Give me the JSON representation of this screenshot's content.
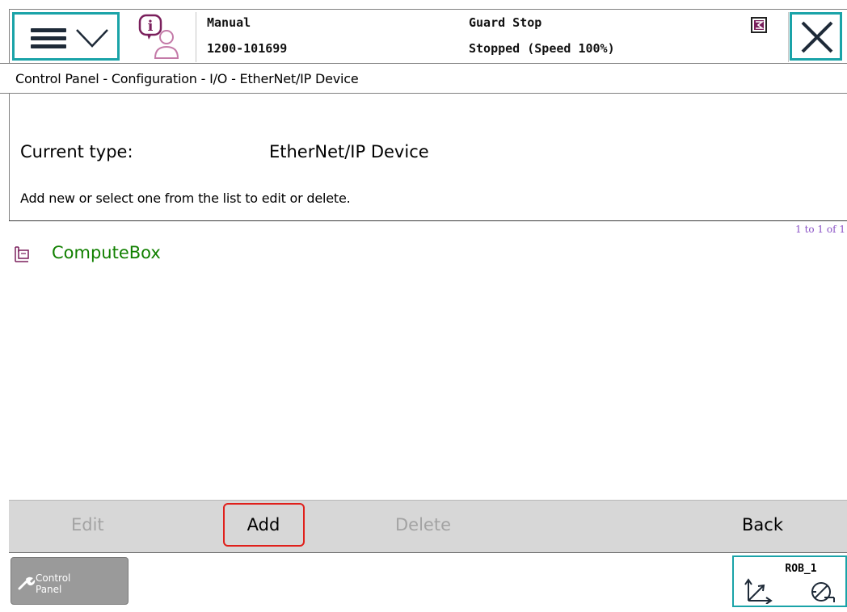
{
  "header": {
    "mode": "Manual",
    "serial": "1200-101699",
    "motor_state": "Guard Stop",
    "speed_state": "Stopped (Speed 100%)"
  },
  "breadcrumb": "Control Panel - Configuration - I/O - EtherNet/IP Device",
  "current_type": {
    "label": "Current type:",
    "value": "EtherNet/IP Device"
  },
  "hint": "Add new or select one from the list to edit or delete.",
  "list": {
    "page_count": "1 to 1 of 1",
    "items": [
      {
        "name": "ComputeBox",
        "icon": "device-icon"
      }
    ]
  },
  "commands": {
    "edit": "Edit",
    "add": "Add",
    "delete": "Delete",
    "back": "Back"
  },
  "taskbar": {
    "control_panel_line1": "Control",
    "control_panel_line2": "Panel",
    "robot_unit": "ROB_1"
  },
  "colors": {
    "accent": "#1aa3a8",
    "list_item_text": "#118000",
    "page_count_text": "#8a52c6",
    "highlight": "#e0201b",
    "disabled_text": "#a3a3a3"
  }
}
